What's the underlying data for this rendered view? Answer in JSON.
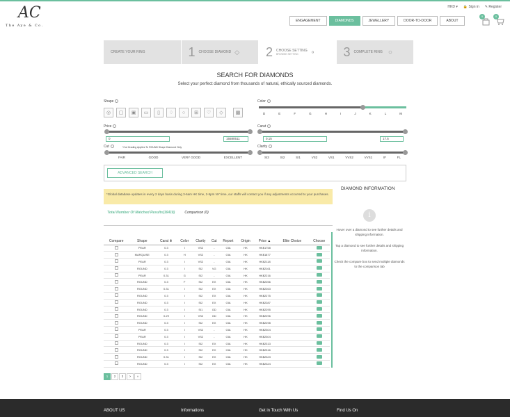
{
  "brand": {
    "monogram": "AC",
    "name": "The Aye & Co."
  },
  "topbar": {
    "currency": "HKD",
    "signin": "Sign in",
    "register": "Register"
  },
  "nav": [
    "ENGAGEMENT",
    "DIAMONDS",
    "JEWELLERY",
    "DOOR-TO-DOOR",
    "ABOUT"
  ],
  "nav_active": 1,
  "cart": {
    "bag_count": "0",
    "cart_count": "0"
  },
  "steps": [
    {
      "num": "",
      "label": "CREATE YOUR RING",
      "sub": ""
    },
    {
      "num": "1",
      "label": "CHOOSE DIAMOND",
      "sub": ""
    },
    {
      "num": "2",
      "label": "CHOOSE SETTING",
      "sub": "BROWSE SETTING"
    },
    {
      "num": "3",
      "label": "COMPLETE RING",
      "sub": ""
    }
  ],
  "heading": "SEARCH FOR DIAMONDS",
  "subheading": "Select your perfect diamond from thousands of natural, ethically sourced diamonds.",
  "filters": {
    "shape_label": "Shape",
    "color_label": "Color",
    "color_scale": [
      "D",
      "E",
      "F",
      "G",
      "H",
      "I",
      "J",
      "K",
      "L",
      "M"
    ],
    "price_label": "Price",
    "price_min": "0",
    "price_max": "15580511",
    "carat_label": "Carat",
    "carat_min": "0.15",
    "carat_max": "17.5",
    "cut_label": "Cut",
    "cut_note": "*Cut Grading Applies To ROUND Shape Diamond Only",
    "cut_scale": [
      "FAIR",
      "GOOD",
      "VERY GOOD",
      "EXCELLENT"
    ],
    "clarity_label": "Clarity",
    "clarity_scale": [
      "SI3",
      "SI2",
      "SI1",
      "VS2",
      "VS1",
      "VVS2",
      "VVS1",
      "IF",
      "FL"
    ]
  },
  "advanced_search": "ADVANCED SEARCH",
  "notice": "*Global database updates in every 2 days basis during 3-6am HK time, 2-5pm NY time, our staffs will contact you if any adjustments occurred to your purchases.",
  "tabs": {
    "results": "Total Number Of Matched Results(16418)",
    "comparison": "Comparison (0)"
  },
  "table": {
    "headers": [
      "Compare",
      "Shape",
      "Carat",
      "Color",
      "Clarity",
      "Cut",
      "Report",
      "Origin",
      "Price",
      "Elite Choice",
      "Choose"
    ],
    "rows": [
      [
        "PEAR",
        "0.3",
        "I",
        "VS2",
        "-",
        "GIA",
        "HK",
        "HK$1758"
      ],
      [
        "MARQUISE",
        "0.3",
        "H",
        "VS2",
        "-",
        "GIA",
        "HK",
        "HK$1877"
      ],
      [
        "PEAR",
        "0.3",
        "I",
        "VS2",
        "-",
        "GIA",
        "HK",
        "HK$2118"
      ],
      [
        "ROUND",
        "0.3",
        "I",
        "SI2",
        "VG",
        "GIA",
        "HK",
        "HK$2161"
      ],
      [
        "PEAR",
        "0.31",
        "G",
        "SI2",
        "-",
        "GIA",
        "HK",
        "HK$2216"
      ],
      [
        "ROUND",
        "0.3",
        "F",
        "SI2",
        "EX",
        "GIA",
        "HK",
        "HK$2256"
      ],
      [
        "ROUND",
        "0.31",
        "I",
        "SI2",
        "EX",
        "GIA",
        "HK",
        "HK$2263"
      ],
      [
        "ROUND",
        "0.3",
        "I",
        "SI2",
        "EX",
        "GIA",
        "HK",
        "HK$2275"
      ],
      [
        "ROUND",
        "0.3",
        "I",
        "SI2",
        "EX",
        "GIA",
        "HK",
        "HK$2287"
      ],
      [
        "ROUND",
        "0.3",
        "I",
        "SI1",
        "GD",
        "GIA",
        "HK",
        "HK$2295"
      ],
      [
        "ROUND",
        "0.29",
        "I",
        "VS2",
        "GD",
        "GIA",
        "HK",
        "HK$2296"
      ],
      [
        "ROUND",
        "0.3",
        "I",
        "SI2",
        "EX",
        "GIA",
        "HK",
        "HK$2298"
      ],
      [
        "PEAR",
        "0.3",
        "I",
        "VS2",
        "-",
        "GIA",
        "HK",
        "HK$2304"
      ],
      [
        "PEAR",
        "0.3",
        "I",
        "VS2",
        "-",
        "GIA",
        "HK",
        "HK$2304"
      ],
      [
        "ROUND",
        "0.3",
        "I",
        "SI2",
        "EX",
        "GIA",
        "HK",
        "HK$2313"
      ],
      [
        "ROUND",
        "0.3",
        "I",
        "SI2",
        "EX",
        "GIA",
        "HK",
        "HK$2316"
      ],
      [
        "ROUND",
        "0.31",
        "I",
        "SI2",
        "EX",
        "GIA",
        "HK",
        "HK$2323"
      ],
      [
        "ROUND",
        "0.3",
        "I",
        "SI2",
        "EX",
        "GIA",
        "HK",
        "HK$2324"
      ]
    ]
  },
  "pager": [
    "1",
    "2",
    "3",
    ">",
    "»"
  ],
  "side": {
    "title": "DIAMOND INFORMATION",
    "icon": "i",
    "p1": "Hover over a diamond to see further details and shipping information.",
    "p2": "Tap a diamond to see further details and shipping information.",
    "p3": "Check the compare box to send multiple diamonds to the comparison tab"
  },
  "footer": [
    "ABOUT US",
    "Informations",
    "Get in Touch With Us",
    "Find Us On"
  ]
}
